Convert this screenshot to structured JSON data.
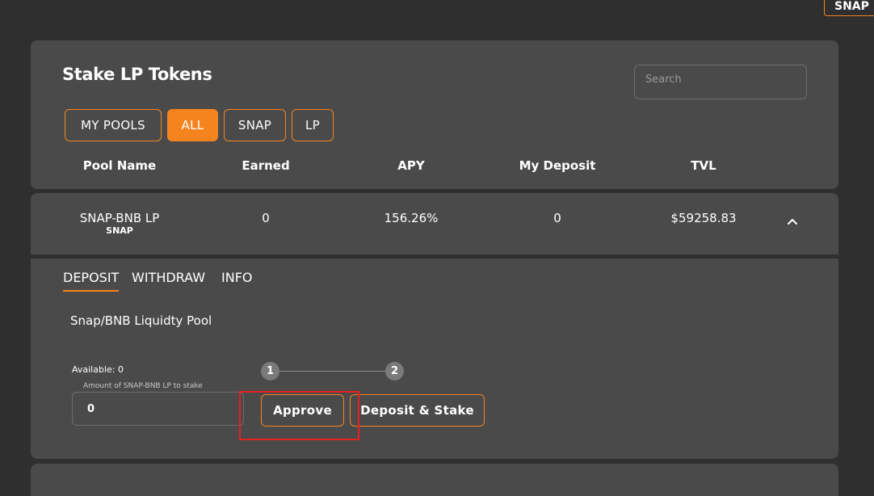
{
  "corner_button": {
    "label": "SNAP"
  },
  "header": {
    "title": "Stake LP Tokens",
    "search": {
      "placeholder": "Search",
      "value": ""
    }
  },
  "filter_tabs": [
    {
      "label": "MY POOLS",
      "active": false
    },
    {
      "label": "ALL",
      "active": true
    },
    {
      "label": "SNAP",
      "active": false
    },
    {
      "label": "LP",
      "active": false
    }
  ],
  "columns": [
    "Pool Name",
    "Earned",
    "APY",
    "My Deposit",
    "TVL"
  ],
  "pool": {
    "name": "SNAP-BNB LP",
    "sub": "SNAP",
    "earned": "0",
    "apy": "156.26%",
    "my_deposit": "0",
    "tvl": "$59258.83",
    "expanded": true
  },
  "detail": {
    "tabs": [
      {
        "label": "DEPOSIT",
        "active": true
      },
      {
        "label": "WITHDRAW",
        "active": false
      },
      {
        "label": "INFO",
        "active": false
      }
    ],
    "description": "Snap/BNB Liquidty Pool",
    "available": "Available: 0",
    "amount_label": "Amount of SNAP-BNB LP to stake",
    "amount_value": "0",
    "steps": [
      "1",
      "2"
    ],
    "approve_label": "Approve",
    "deposit_label": "Deposit & Stake"
  },
  "colors": {
    "accent": "#f5841f",
    "panel": "#4a4a4a",
    "background": "#2f2f2f",
    "highlight": "#e8201e"
  },
  "icons": {
    "collapse": "chevron-up-icon"
  }
}
